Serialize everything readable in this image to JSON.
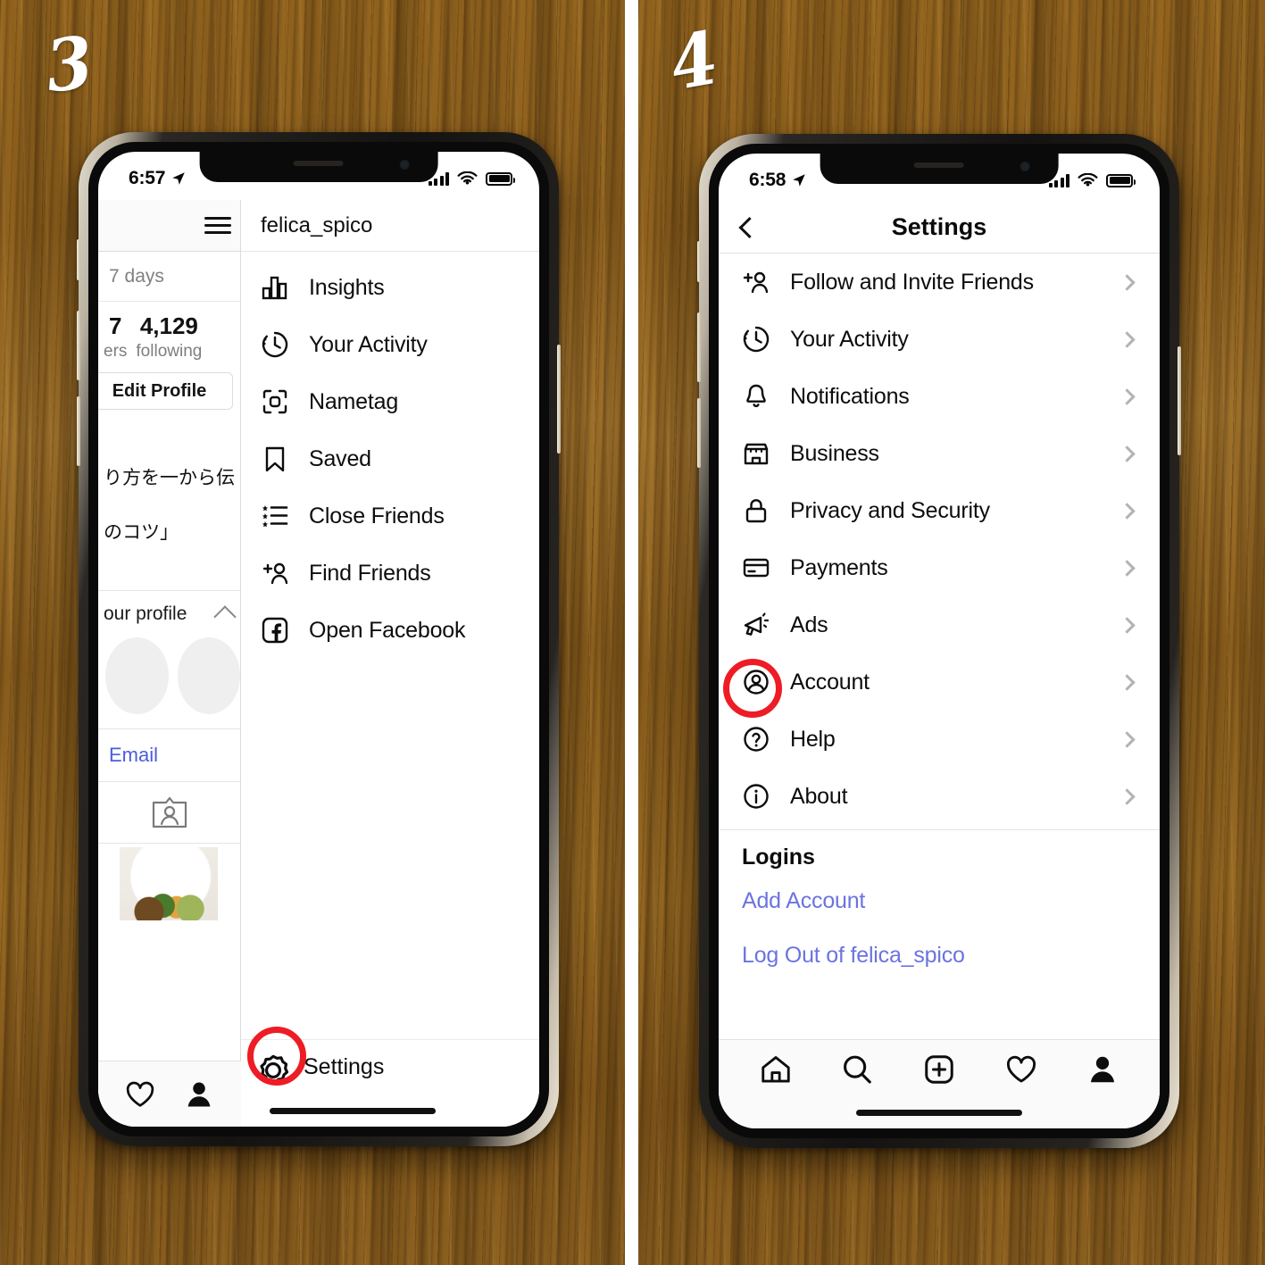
{
  "steps": {
    "left_number": "3",
    "right_number": "4"
  },
  "left_phone": {
    "status": {
      "time": "6:57",
      "location_icon": "location-arrow-icon",
      "signal": "signal-bars-icon",
      "wifi": "wifi-icon",
      "battery": "battery-full-icon"
    },
    "profile_panel": {
      "menu_icon": "hamburger-icon",
      "days_label": "7 days",
      "stats": [
        {
          "num": "7",
          "label": "ers"
        },
        {
          "num": "4,129",
          "label": "following"
        }
      ],
      "edit_profile_label": "Edit Profile",
      "bio_line_1": "り方を一から伝",
      "bio_line_2": "のコツ」",
      "your_profile_label": "our profile",
      "collapse_icon": "chevron-up-icon",
      "email_label": "Email",
      "id_card_icon": "id-card-icon",
      "photo_alt": "food-photo-thumbnail",
      "tabs": [
        {
          "icon": "heart-icon",
          "label": "Activity"
        },
        {
          "icon": "person-filled-icon",
          "label": "Profile"
        }
      ]
    },
    "menu_panel": {
      "username": "felica_spico",
      "items": [
        {
          "icon": "insights-bar-chart-icon",
          "label": "Insights"
        },
        {
          "icon": "your-activity-clock-icon",
          "label": "Your Activity"
        },
        {
          "icon": "nametag-scan-icon",
          "label": "Nametag"
        },
        {
          "icon": "saved-bookmark-icon",
          "label": "Saved"
        },
        {
          "icon": "close-friends-star-list-icon",
          "label": "Close Friends"
        },
        {
          "icon": "find-friends-person-plus-icon",
          "label": "Find Friends"
        },
        {
          "icon": "facebook-icon",
          "label": "Open Facebook"
        }
      ],
      "settings": {
        "icon": "settings-gear-icon",
        "label": "Settings",
        "highlighted": true
      }
    }
  },
  "right_phone": {
    "status": {
      "time": "6:58",
      "location_icon": "location-arrow-icon",
      "signal": "signal-bars-icon",
      "wifi": "wifi-icon",
      "battery": "battery-full-icon"
    },
    "nav": {
      "back_icon": "chevron-left-icon",
      "title": "Settings"
    },
    "settings_items": [
      {
        "icon": "person-plus-icon",
        "label": "Follow and Invite Friends"
      },
      {
        "icon": "clock-activity-icon",
        "label": "Your Activity"
      },
      {
        "icon": "bell-icon",
        "label": "Notifications"
      },
      {
        "icon": "storefront-icon",
        "label": "Business"
      },
      {
        "icon": "lock-icon",
        "label": "Privacy and Security"
      },
      {
        "icon": "credit-card-icon",
        "label": "Payments"
      },
      {
        "icon": "megaphone-icon",
        "label": "Ads"
      },
      {
        "icon": "account-person-circle-icon",
        "label": "Account",
        "highlighted": true
      },
      {
        "icon": "question-circle-icon",
        "label": "Help"
      },
      {
        "icon": "info-circle-icon",
        "label": "About"
      }
    ],
    "logins": {
      "title": "Logins",
      "links": [
        {
          "label": "Add Account"
        },
        {
          "label": "Log Out of felica_spico"
        }
      ]
    },
    "tabs": [
      {
        "icon": "home-icon"
      },
      {
        "icon": "search-icon"
      },
      {
        "icon": "add-post-icon"
      },
      {
        "icon": "heart-icon"
      },
      {
        "icon": "profile-person-icon"
      }
    ]
  },
  "colors": {
    "highlight_ring": "#ee1c25",
    "link_blue": "#6b73e0",
    "wood_brown": "#8e6220"
  }
}
